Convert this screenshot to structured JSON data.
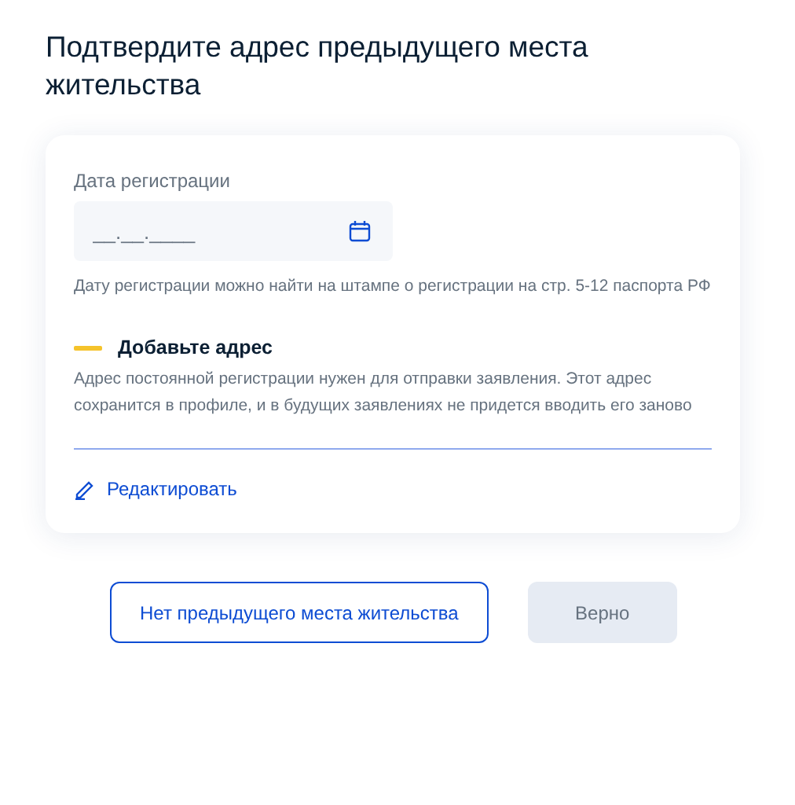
{
  "title": "Подтвердите адрес предыдущего места жительства",
  "date_field": {
    "label": "Дата регистрации",
    "placeholder": "__.__.____",
    "hint": "Дату регистрации можно найти на штампе о регистрации на стр. 5-12 паспорта РФ"
  },
  "address": {
    "color": "#f5c32b",
    "heading": "Добавьте адрес",
    "description": "Адрес постоянной регистрации нужен для отправки заявления. Этот адрес сохранится в профиле, и в будущих заявлениях не придется вводить его заново",
    "edit_link": "Редактировать"
  },
  "buttons": [
    {
      "label": "Нет предыдущего места жительства",
      "kind": "outline",
      "disabled": false
    },
    {
      "label": "Верно",
      "kind": "primary",
      "disabled": true
    }
  ]
}
